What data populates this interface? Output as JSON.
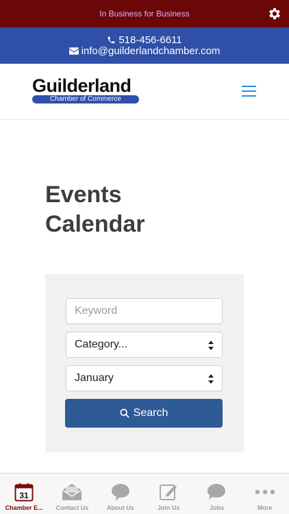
{
  "colors": {
    "topbar_bg": "#6b0707",
    "topbar_text": "#d9b3ff",
    "contactbar_bg": "#2f4fa8",
    "hamburger": "#2a8de0",
    "search_button_bg": "#2e5a96",
    "active_tab": "#7a0b0b",
    "inactive_tab": "#9b9b9b"
  },
  "topbar": {
    "tagline": "In Business for Business",
    "settings_icon": "gear-icon"
  },
  "contact": {
    "phone": "518-456-6611",
    "email": "info@guilderlandchamber.com"
  },
  "logo": {
    "title": "Guilderland",
    "subtitle": "Chamber of Commerce"
  },
  "page": {
    "title_line1": "Events",
    "title_line2": "Calendar"
  },
  "search": {
    "keyword_placeholder": "Keyword",
    "category_value": "Category...",
    "month_value": "January",
    "button_label": "Search"
  },
  "tabs": [
    {
      "label": "Chamber E...",
      "icon": "calendar-icon",
      "calendar_day": "31",
      "active": true
    },
    {
      "label": "Contact Us",
      "icon": "envelope-icon"
    },
    {
      "label": "About Us",
      "icon": "speech-bubble-icon"
    },
    {
      "label": "Join Us",
      "icon": "edit-icon"
    },
    {
      "label": "Jobs",
      "icon": "chat-bubble-icon"
    },
    {
      "label": "More",
      "icon": "more-dots-icon"
    }
  ]
}
